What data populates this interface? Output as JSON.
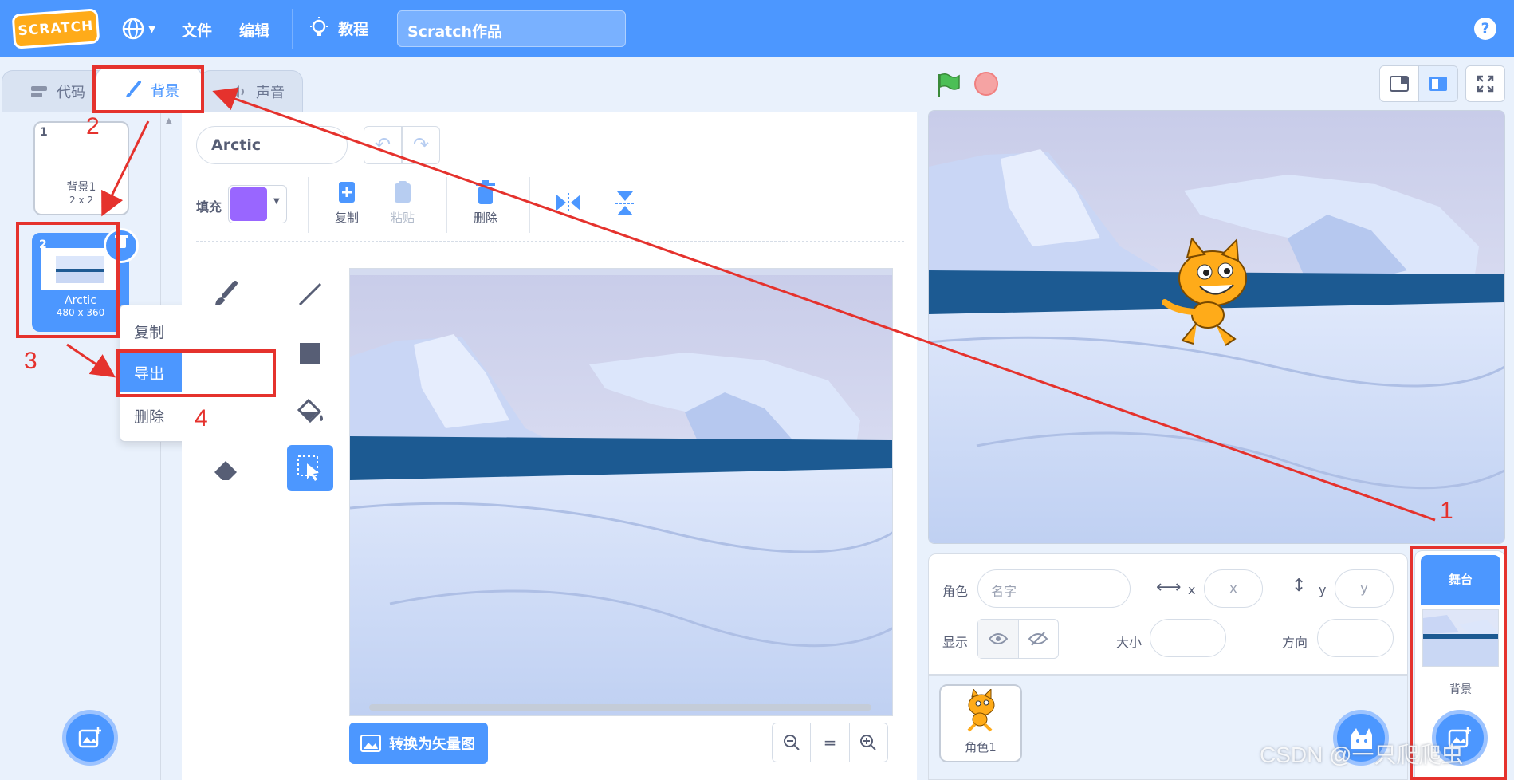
{
  "menubar": {
    "logo": "SCRATCH",
    "file": "文件",
    "edit": "编辑",
    "tutorials": "教程",
    "project_title": "Scratch作品",
    "help": "?"
  },
  "tabs": [
    {
      "label": "代码"
    },
    {
      "label": "背景"
    },
    {
      "label": "声音"
    }
  ],
  "costumes": [
    {
      "num": "1",
      "name": "背景1",
      "size": "2 x 2"
    },
    {
      "num": "2",
      "name": "Arctic",
      "size": "480 x 360"
    }
  ],
  "context_menu": {
    "duplicate": "复制",
    "export": "导出",
    "delete": "删除"
  },
  "editor": {
    "costume_name": "Arctic",
    "fill_label": "填充",
    "fill_color": "#9966ff",
    "copy": "复制",
    "paste": "粘贴",
    "delete": "删除",
    "convert": "转换为矢量图",
    "zoom_reset": "="
  },
  "sprite_info": {
    "sprite_label": "角色",
    "name_placeholder": "名字",
    "x_label": "x",
    "x_placeholder": "x",
    "y_label": "y",
    "y_placeholder": "y",
    "show_label": "显示",
    "size_label": "大小",
    "direction_label": "方向"
  },
  "sprite_list": [
    {
      "name": "角色1"
    }
  ],
  "stage_pane": {
    "stage_label": "舞台",
    "backdrop_label": "背景"
  },
  "annotations": {
    "n1": "1",
    "n2": "2",
    "n3": "3",
    "n4": "4"
  },
  "watermark": "CSDN @一只爬爬虫",
  "colors": {
    "accent": "#4c97ff",
    "annotation": "#e5322d",
    "orange_logo": "#ffab19"
  }
}
